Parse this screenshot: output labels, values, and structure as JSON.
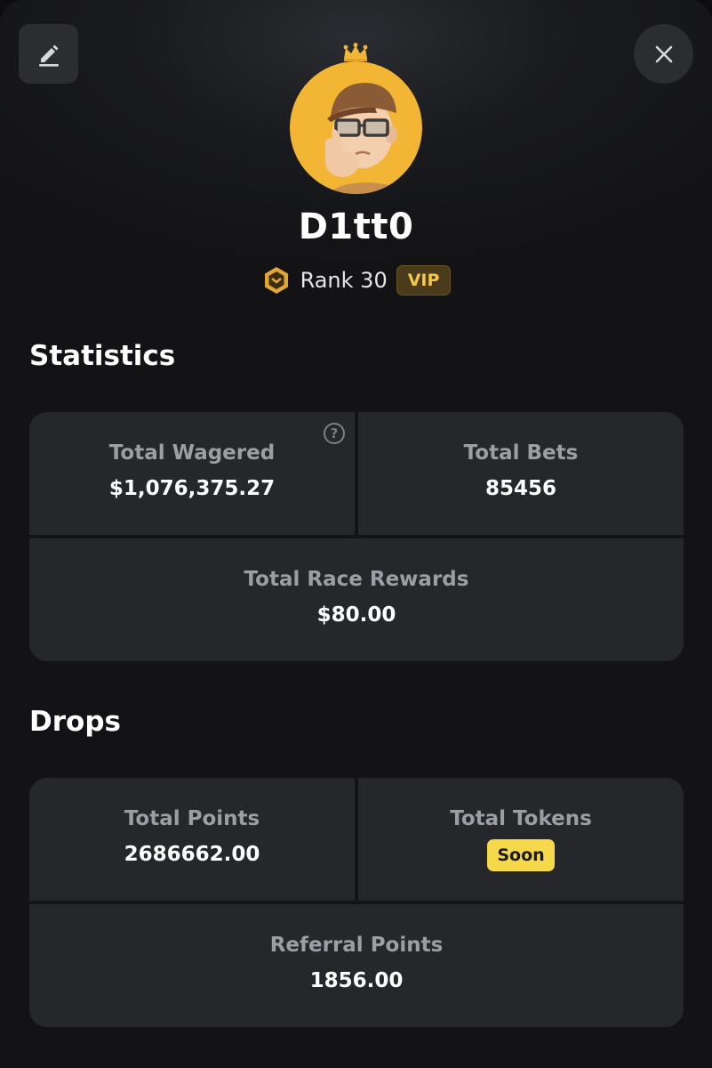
{
  "header": {
    "edit_icon": "pencil-edit-icon",
    "close_icon": "close-x-icon"
  },
  "profile": {
    "username": "D1tt0",
    "rank_label": "Rank 30",
    "vip_label": "VIP",
    "crown_icon": "crown-icon",
    "rank_icon": "hexagon-rank-icon"
  },
  "statistics": {
    "title": "Statistics",
    "total_wagered_label": "Total Wagered",
    "total_wagered_value": "$1,076,375.27",
    "help_glyph": "?",
    "total_bets_label": "Total Bets",
    "total_bets_value": "85456",
    "total_race_rewards_label": "Total Race Rewards",
    "total_race_rewards_value": "$80.00"
  },
  "drops": {
    "title": "Drops",
    "total_points_label": "Total Points",
    "total_points_value": "2686662.00",
    "total_tokens_label": "Total Tokens",
    "total_tokens_badge": "Soon",
    "referral_points_label": "Referral Points",
    "referral_points_value": "1856.00"
  },
  "colors": {
    "accent_gold": "#f4c64a",
    "soon_badge": "#f6d94a",
    "avatar_bg": "#f2b534",
    "card_bg": "#26272b"
  }
}
